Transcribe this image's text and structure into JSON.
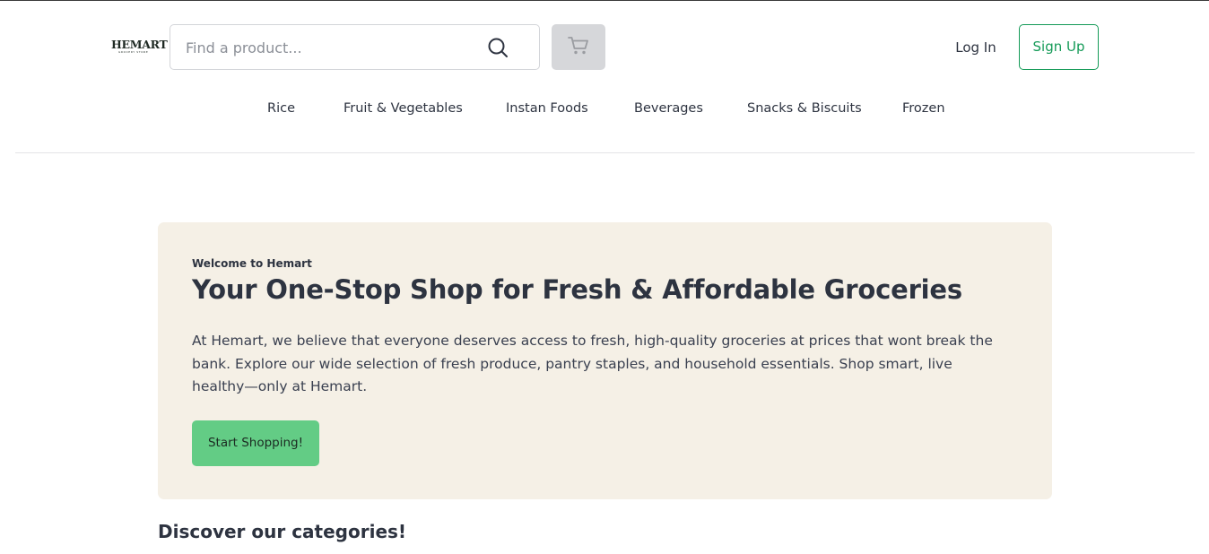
{
  "header": {
    "logo": {
      "brand": "HEMART",
      "tagline": "GROCERY STORE"
    },
    "search": {
      "placeholder": "Find a product...",
      "value": ""
    },
    "cart": {
      "icon": "cart-icon"
    },
    "login_label": "Log In",
    "signup_label": "Sign Up"
  },
  "nav": {
    "categories": [
      "Rice",
      "Fruit & Vegetables",
      "Instan Foods",
      "Beverages",
      "Snacks & Biscuits",
      "Frozen"
    ]
  },
  "hero": {
    "eyebrow": "Welcome to Hemart",
    "title": "Your One-Stop Shop for Fresh & Affordable Groceries",
    "description": "At Hemart, we believe that everyone deserves access to fresh, high-quality groceries at prices that wont break the bank. Explore our wide selection of fresh produce, pantry staples, and household essentials. Shop smart, live healthy—only at Hemart.",
    "cta_label": "Start Shopping!"
  },
  "categories_section": {
    "heading": "Discover our categories!"
  },
  "colors": {
    "accent_green": "#149a57",
    "cta_green": "#63cc85",
    "hero_bg": "#f5f0e6",
    "text_dark": "#2d3340"
  }
}
